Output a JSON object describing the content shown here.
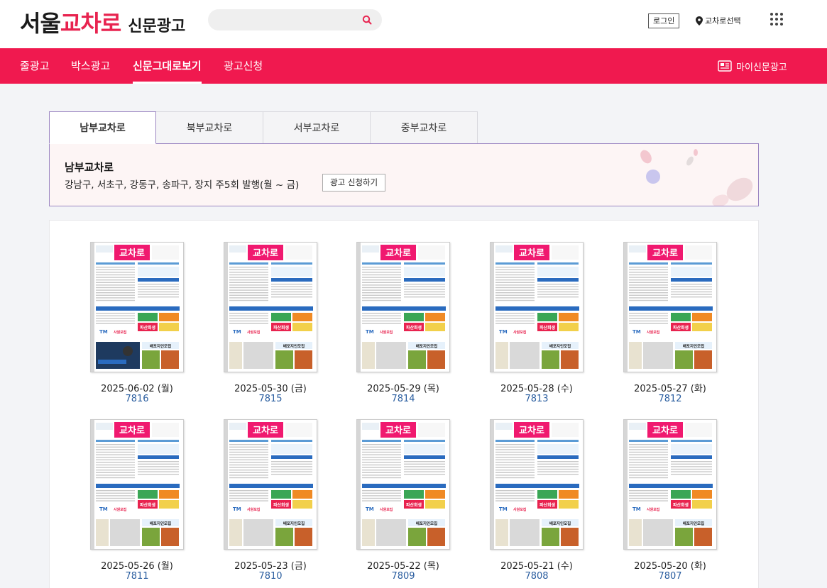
{
  "header": {
    "logo": {
      "part1": "서울",
      "part2": "교차로",
      "part3": "신문광고"
    },
    "search": {
      "placeholder": "",
      "value": ""
    },
    "login_label": "로그인",
    "region_label": "교차로선택"
  },
  "nav": {
    "items": [
      {
        "label": "줄광고"
      },
      {
        "label": "박스광고"
      },
      {
        "label": "신문그대로보기"
      },
      {
        "label": "광고신청"
      }
    ],
    "active_index": 2,
    "my_ad_label": "마이신문광고"
  },
  "tabs": [
    {
      "label": "남부교차로"
    },
    {
      "label": "북부교차로"
    },
    {
      "label": "서부교차로"
    },
    {
      "label": "중부교차로"
    }
  ],
  "info": {
    "title": "남부교차로",
    "description": "강남구, 서초구, 강동구, 송파구, 장지 주5회 발행(월 ~ 금)",
    "apply_label": "광고 신청하기"
  },
  "issues": [
    {
      "date": "2025-06-02 (월)",
      "number": "7816"
    },
    {
      "date": "2025-05-30 (금)",
      "number": "7815"
    },
    {
      "date": "2025-05-29 (목)",
      "number": "7814"
    },
    {
      "date": "2025-05-28 (수)",
      "number": "7813"
    },
    {
      "date": "2025-05-27 (화)",
      "number": "7812"
    },
    {
      "date": "2025-05-26 (월)",
      "number": "7811"
    },
    {
      "date": "2025-05-23 (금)",
      "number": "7810"
    },
    {
      "date": "2025-05-22 (목)",
      "number": "7809"
    },
    {
      "date": "2025-05-21 (수)",
      "number": "7808"
    },
    {
      "date": "2025-05-20 (화)",
      "number": "7807"
    }
  ],
  "thumb_text": {
    "masthead": "교차로",
    "ad_recruit": "사원모집",
    "ad_delivery": "배포지인모집",
    "ad_bankruptcy": "파산회생",
    "ad_tm": "TM"
  },
  "colors": {
    "brand": "#f0194f",
    "logo_accent": "#e8234f",
    "tab_border": "#9c86c2",
    "issue_link": "#2a5d9f"
  }
}
